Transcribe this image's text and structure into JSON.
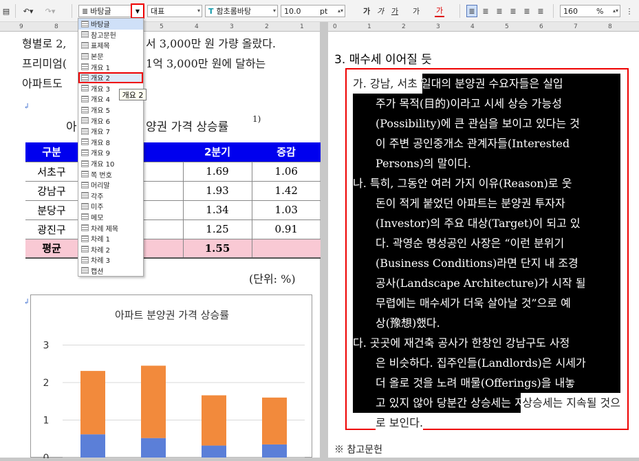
{
  "toolbar": {
    "style_combo": "바탕글",
    "style_items_label": "대표",
    "font": "함초롬바탕",
    "size_value": "10.0",
    "size_unit": "pt",
    "zoom": "160",
    "zoom_unit": "%",
    "btn_bold": "가",
    "btn_italic": "가",
    "btn_underline": "가",
    "btn_strike": "가",
    "btn_color": "가"
  },
  "ruler_left": [
    "9",
    "8",
    "7",
    "6",
    "5",
    "4",
    "3",
    "2",
    "1"
  ],
  "ruler_right": [
    "0",
    "1",
    "2",
    "3",
    "4",
    "5",
    "6",
    "7",
    "8"
  ],
  "style_menu": [
    "바탕글",
    "참고문헌",
    "표제목",
    "본문",
    "개요 1",
    "개요 2",
    "개요 3",
    "개요 4",
    "개요 5",
    "개요 6",
    "개요 7",
    "개요 8",
    "개요 9",
    "개요 10",
    "쪽 번호",
    "머리말",
    "각주",
    "미주",
    "메모",
    "차례 제목",
    "차례 1",
    "차례 2",
    "차례 3",
    "캡션"
  ],
  "tooltip": "개요 2",
  "left": {
    "line1a": "형별로 2,",
    "line1b": "서 3,000만 원 가량 올랐다.",
    "line2a": "프리미엄(",
    "line2b": "1억 3,000만 원에 달하는",
    "line3": "아파트도",
    "table_title_a": "아",
    "table_title_b": "양권 가격 상승률",
    "table_sup": "1)",
    "headers": [
      "구분",
      "",
      "2분기",
      "증감"
    ],
    "rows": [
      [
        "서초구",
        "",
        "1.69",
        "1.06"
      ],
      [
        "강남구",
        "",
        "1.93",
        "1.42"
      ],
      [
        "분당구",
        "",
        "1.34",
        "1.03"
      ],
      [
        "광진구",
        "",
        "1.25",
        "0.91"
      ]
    ],
    "avg": [
      "평균",
      "",
      "1.55",
      ""
    ],
    "unit": "(단위: %)"
  },
  "chart_data": {
    "type": "bar",
    "title": "아파트 분양권 가격 상승률",
    "ylim": [
      0,
      3
    ],
    "yticks": [
      "0",
      "1",
      "2",
      "3"
    ],
    "series": [
      {
        "values": [
          0.62,
          0.52,
          0.32,
          0.35
        ],
        "color": "#5b7fd8"
      },
      {
        "values": [
          1.69,
          1.93,
          1.34,
          1.25
        ],
        "color": "#f28a3c"
      }
    ]
  },
  "right": {
    "heading": "3. 매수세 이어질 듯",
    "a": [
      "가. 강남, 서초 일대의 분양권 수요자들은 실입",
      "주가 목적(目的)이라고 시세 상승 가능성",
      "(Possibility)에 큰 관심을 보이고 있다는 것",
      "이 주변 공인중개소 관계자들(Interested",
      "Persons)의 말이다."
    ],
    "b": [
      "나. 특히, 그동안 여러 가지 이유(Reason)로 웃",
      "돈이 적게 붙었던 아파트는 분양권 투자자",
      "(Investor)의 주요 대상(Target)이 되고 있",
      "다. 곽영순 명성공인 사장은 “이런 분위기",
      "(Business Conditions)라면 단지 내 조경",
      "공사(Landscape Architecture)가 시작 될",
      "무렵에는 매수세가 더욱 살아날 것”으로 예",
      "상(豫想)했다."
    ],
    "c": [
      "다. 곳곳에 재건축 공사가 한창인 강남구도 사정",
      "은 비슷하다. 집주인들(Landlords)은 시세가",
      "더 올로 것을 노려 매물(Offerings)을 내놓",
      "고 있지 않아 당분간 상승세는 지속될 것으",
      "로 보인다."
    ],
    "footer": "※ 참고문헌"
  }
}
